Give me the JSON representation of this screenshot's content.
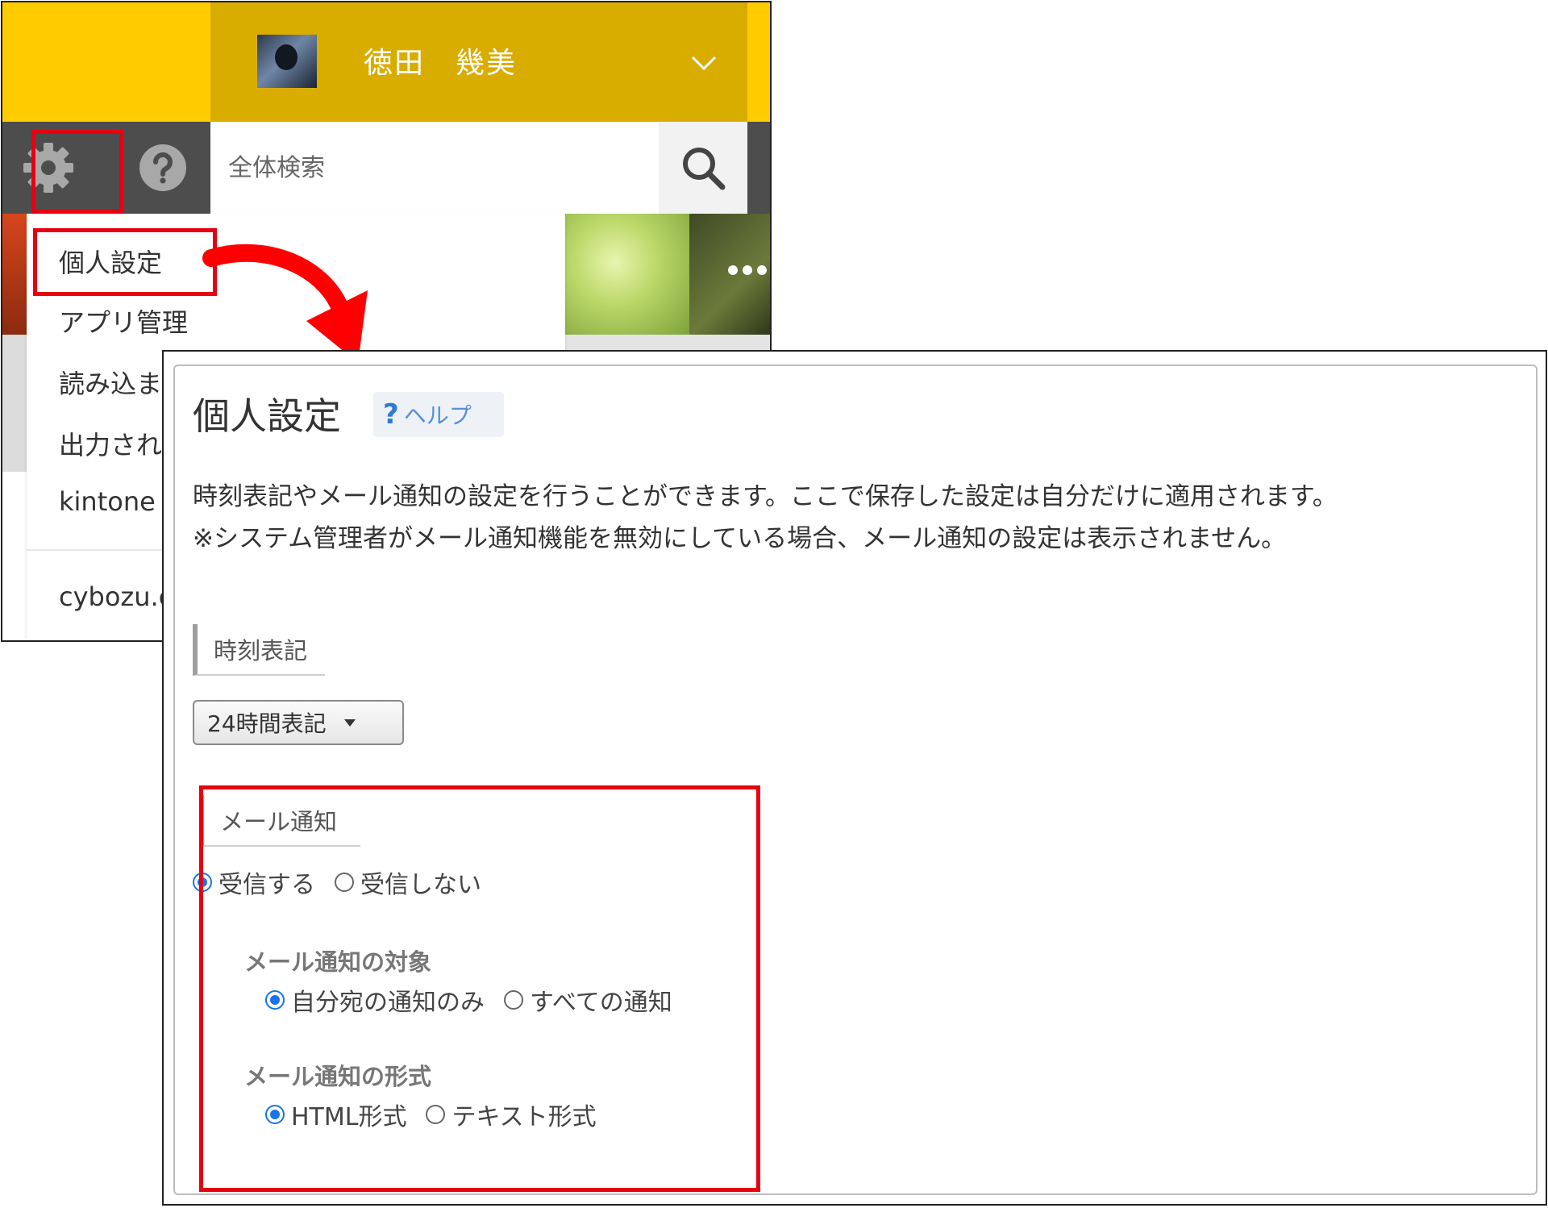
{
  "header": {
    "user_name": "徳田　幾美",
    "search_placeholder": "全体検索"
  },
  "menu": {
    "items": [
      "個人設定",
      "アプリ管理",
      "読み込ま",
      "出力され",
      "kintone"
    ],
    "footer_item": "cybozu.c"
  },
  "settings": {
    "title": "個人設定",
    "help_label": "ヘルプ",
    "description_line1": "時刻表記やメール通知の設定を行うことができます。ここで保存した設定は自分だけに適用されます。",
    "description_line2": "※システム管理者がメール通知機能を無効にしている場合、メール通知の設定は表示されません。",
    "time_section": {
      "heading": "時刻表記",
      "selected_option": "24時間表記"
    },
    "mail_section": {
      "heading": "メール通知",
      "receive_options": [
        "受信する",
        "受信しない"
      ],
      "receive_selected": "受信する",
      "target_label": "メール通知の対象",
      "target_options": [
        "自分宛の通知のみ",
        "すべての通知"
      ],
      "target_selected": "自分宛の通知のみ",
      "format_label": "メール通知の形式",
      "format_options": [
        "HTML形式",
        "テキスト形式"
      ],
      "format_selected": "HTML形式"
    }
  },
  "colors": {
    "header_yellow": "#ffcc00",
    "user_area": "#d9ac00",
    "toolbar": "#4d4d4d",
    "highlight_red": "#e60012",
    "radio_blue": "#1a73e8"
  },
  "icons": [
    "gear-icon",
    "help-icon",
    "search-icon",
    "chevron-down-icon",
    "arrow-icon"
  ]
}
